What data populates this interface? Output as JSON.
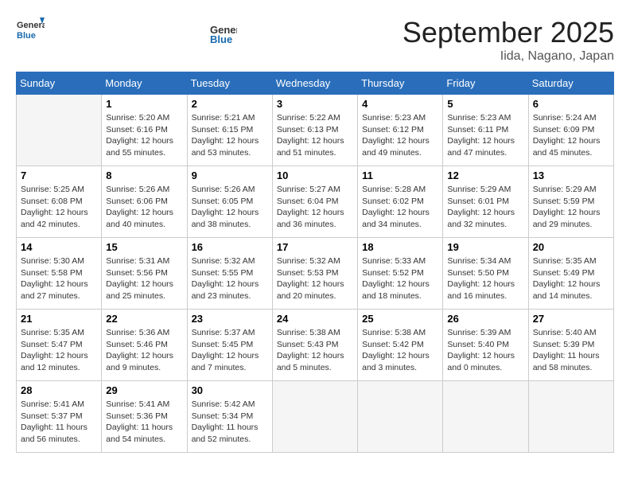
{
  "header": {
    "logo_line1": "General",
    "logo_line2": "Blue",
    "month_title": "September 2025",
    "location": "Iida, Nagano, Japan"
  },
  "days_of_week": [
    "Sunday",
    "Monday",
    "Tuesday",
    "Wednesday",
    "Thursday",
    "Friday",
    "Saturday"
  ],
  "weeks": [
    [
      {
        "day": "",
        "empty": true
      },
      {
        "day": "1",
        "sunrise": "5:20 AM",
        "sunset": "6:16 PM",
        "daylight": "12 hours and 55 minutes."
      },
      {
        "day": "2",
        "sunrise": "5:21 AM",
        "sunset": "6:15 PM",
        "daylight": "12 hours and 53 minutes."
      },
      {
        "day": "3",
        "sunrise": "5:22 AM",
        "sunset": "6:13 PM",
        "daylight": "12 hours and 51 minutes."
      },
      {
        "day": "4",
        "sunrise": "5:23 AM",
        "sunset": "6:12 PM",
        "daylight": "12 hours and 49 minutes."
      },
      {
        "day": "5",
        "sunrise": "5:23 AM",
        "sunset": "6:11 PM",
        "daylight": "12 hours and 47 minutes."
      },
      {
        "day": "6",
        "sunrise": "5:24 AM",
        "sunset": "6:09 PM",
        "daylight": "12 hours and 45 minutes."
      }
    ],
    [
      {
        "day": "7",
        "sunrise": "5:25 AM",
        "sunset": "6:08 PM",
        "daylight": "12 hours and 42 minutes."
      },
      {
        "day": "8",
        "sunrise": "5:26 AM",
        "sunset": "6:06 PM",
        "daylight": "12 hours and 40 minutes."
      },
      {
        "day": "9",
        "sunrise": "5:26 AM",
        "sunset": "6:05 PM",
        "daylight": "12 hours and 38 minutes."
      },
      {
        "day": "10",
        "sunrise": "5:27 AM",
        "sunset": "6:04 PM",
        "daylight": "12 hours and 36 minutes."
      },
      {
        "day": "11",
        "sunrise": "5:28 AM",
        "sunset": "6:02 PM",
        "daylight": "12 hours and 34 minutes."
      },
      {
        "day": "12",
        "sunrise": "5:29 AM",
        "sunset": "6:01 PM",
        "daylight": "12 hours and 32 minutes."
      },
      {
        "day": "13",
        "sunrise": "5:29 AM",
        "sunset": "5:59 PM",
        "daylight": "12 hours and 29 minutes."
      }
    ],
    [
      {
        "day": "14",
        "sunrise": "5:30 AM",
        "sunset": "5:58 PM",
        "daylight": "12 hours and 27 minutes."
      },
      {
        "day": "15",
        "sunrise": "5:31 AM",
        "sunset": "5:56 PM",
        "daylight": "12 hours and 25 minutes."
      },
      {
        "day": "16",
        "sunrise": "5:32 AM",
        "sunset": "5:55 PM",
        "daylight": "12 hours and 23 minutes."
      },
      {
        "day": "17",
        "sunrise": "5:32 AM",
        "sunset": "5:53 PM",
        "daylight": "12 hours and 20 minutes."
      },
      {
        "day": "18",
        "sunrise": "5:33 AM",
        "sunset": "5:52 PM",
        "daylight": "12 hours and 18 minutes."
      },
      {
        "day": "19",
        "sunrise": "5:34 AM",
        "sunset": "5:50 PM",
        "daylight": "12 hours and 16 minutes."
      },
      {
        "day": "20",
        "sunrise": "5:35 AM",
        "sunset": "5:49 PM",
        "daylight": "12 hours and 14 minutes."
      }
    ],
    [
      {
        "day": "21",
        "sunrise": "5:35 AM",
        "sunset": "5:47 PM",
        "daylight": "12 hours and 12 minutes."
      },
      {
        "day": "22",
        "sunrise": "5:36 AM",
        "sunset": "5:46 PM",
        "daylight": "12 hours and 9 minutes."
      },
      {
        "day": "23",
        "sunrise": "5:37 AM",
        "sunset": "5:45 PM",
        "daylight": "12 hours and 7 minutes."
      },
      {
        "day": "24",
        "sunrise": "5:38 AM",
        "sunset": "5:43 PM",
        "daylight": "12 hours and 5 minutes."
      },
      {
        "day": "25",
        "sunrise": "5:38 AM",
        "sunset": "5:42 PM",
        "daylight": "12 hours and 3 minutes."
      },
      {
        "day": "26",
        "sunrise": "5:39 AM",
        "sunset": "5:40 PM",
        "daylight": "12 hours and 0 minutes."
      },
      {
        "day": "27",
        "sunrise": "5:40 AM",
        "sunset": "5:39 PM",
        "daylight": "11 hours and 58 minutes."
      }
    ],
    [
      {
        "day": "28",
        "sunrise": "5:41 AM",
        "sunset": "5:37 PM",
        "daylight": "11 hours and 56 minutes."
      },
      {
        "day": "29",
        "sunrise": "5:41 AM",
        "sunset": "5:36 PM",
        "daylight": "11 hours and 54 minutes."
      },
      {
        "day": "30",
        "sunrise": "5:42 AM",
        "sunset": "5:34 PM",
        "daylight": "11 hours and 52 minutes."
      },
      {
        "day": "",
        "empty": true
      },
      {
        "day": "",
        "empty": true
      },
      {
        "day": "",
        "empty": true
      },
      {
        "day": "",
        "empty": true
      }
    ]
  ],
  "labels": {
    "sunrise": "Sunrise:",
    "sunset": "Sunset:",
    "daylight": "Daylight:"
  }
}
